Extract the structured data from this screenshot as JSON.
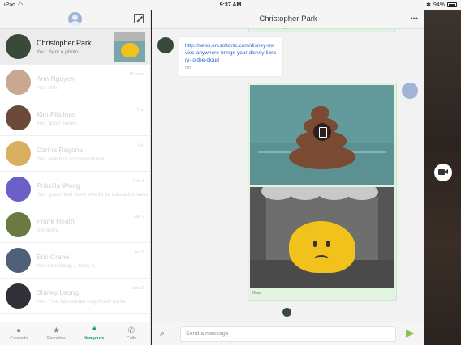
{
  "status_bar": {
    "carrier": "iPad",
    "time": "9:37 AM",
    "battery": "94%"
  },
  "conversations": [
    {
      "name": "Christopher Park",
      "snippet": "You: Sent a photo",
      "time": "",
      "active": true,
      "avatar_color": "#3a4a3a"
    },
    {
      "name": "Ann Nguyen",
      "snippet": "You: ahh",
      "time": "18 mins",
      "active": false,
      "avatar_color": "#c8a890"
    },
    {
      "name": "Kim Filipinas",
      "snippet": "You: good nieces",
      "time": "Thu",
      "active": false,
      "avatar_color": "#6b4a3a"
    },
    {
      "name": "Corina Ragone",
      "snippet": "You: which is unconventional",
      "time": "Sat",
      "active": false,
      "avatar_color": "#d8b060"
    },
    {
      "name": "Priscilla Wong",
      "snippet": "You: guess that there should be education ways",
      "time": "Feb 8",
      "active": false,
      "avatar_color": "#6a60c8"
    },
    {
      "name": "Frank Heath",
      "snippet": "Seriously",
      "time": "Jan 7",
      "active": false,
      "avatar_color": "#6a7a40"
    },
    {
      "name": "Eric Crane",
      "snippet": "Yes interesting.... Mary C",
      "time": "Jan 8",
      "active": false,
      "avatar_color": "#506078"
    },
    {
      "name": "Shirley Leong",
      "snippet": "You: That hamburger-bag finally came",
      "time": "Jan 11",
      "active": false,
      "avatar_color": "#303038"
    }
  ],
  "bottom_nav": [
    {
      "label": "Contacts",
      "icon": "person-icon",
      "active": false
    },
    {
      "label": "Favorites",
      "icon": "star-icon",
      "active": false
    },
    {
      "label": "Hangouts",
      "icon": "hangouts-icon",
      "active": true
    },
    {
      "label": "Calls",
      "icon": "phone-icon",
      "active": false
    }
  ],
  "chat": {
    "title": "Christopher Park",
    "link_message": {
      "url": "http://news.en.softonic.com/disney-movies-anywhere-brings-your-disney-library-to-the-cloud",
      "time": "5m"
    },
    "photo_message": {
      "time": "Now"
    },
    "composer": {
      "placeholder": "Send a message"
    }
  },
  "colors": {
    "accent_green": "#0f9d58",
    "bubble_green": "#e2f3df",
    "link_blue": "#2962c4"
  }
}
